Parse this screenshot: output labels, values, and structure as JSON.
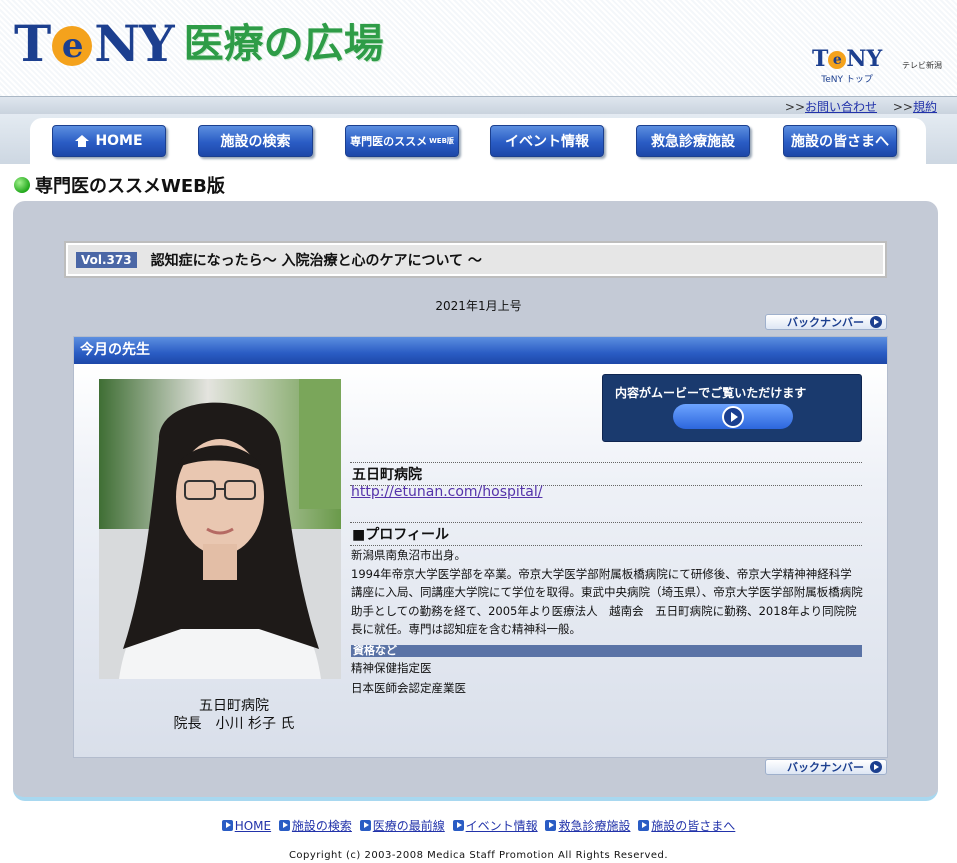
{
  "header": {
    "logo_main": "T",
    "logo_e": "e",
    "logo_rest": "NY",
    "logo_sub": "医療の広場",
    "tony_small_t": "T",
    "tony_small_e": "e",
    "tony_small_rest": "NY",
    "tony_small_caption": "テレビ新潟",
    "tony_top_link": "TeNY トップ"
  },
  "toplinks": {
    "prefix1": ">>",
    "contact": "お問い合わせ",
    "prefix2": ">>",
    "terms": "規約"
  },
  "nav": {
    "home": "HOME",
    "search": "施設の検索",
    "specialist": "専門医のススメ",
    "specialist_sub": "WEB版",
    "events": "イベント情報",
    "emergency": "救急診療施設",
    "facilities": "施設の皆さまへ"
  },
  "page": {
    "title": "専門医のススメWEB版"
  },
  "article": {
    "vol": "Vol.373",
    "title": "認知症になったら～ 入院治療と心のケアについて ～",
    "date": "2021年1月上号",
    "backnumber": "バックナンバー"
  },
  "doctor_box": {
    "header": "今月の先生",
    "caption_line1": "五日町病院",
    "caption_line2": "院長　小川 杉子 氏",
    "movie_text": "内容がムービーでご覧いただけます",
    "hospital_name": "五日町病院",
    "hospital_url": "http://etunan.com/hospital/",
    "profile_heading": "■プロフィール",
    "profile_text": "新潟県南魚沼市出身。\n1994年帝京大学医学部を卒業。帝京大学医学部附属板橋病院にて研修後、帝京大学精神神経科学講座に入局、同講座大学院にて学位を取得。東武中央病院（埼玉県）、帝京大学医学部附属板橋病院助手としての勤務を経て、2005年より医療法人　越南会　五日町病院に勤務、2018年より同院院長に就任。専門は認知症を含む精神科一般。",
    "qualifications_label": "資格など",
    "qualifications": [
      "精神保健指定医",
      "日本医師会認定産業医"
    ]
  },
  "footer": {
    "links": [
      "HOME",
      "施設の検索",
      "医療の最前線",
      "イベント情報",
      "救急診療施設",
      "施設の皆さまへ"
    ],
    "copyright": "Copyright (c) 2003-2008 Medica Staff Promotion All Rights Reserved."
  },
  "colors": {
    "brand_blue": "#1c3f8f",
    "brand_green": "#2e9c47",
    "nav_blue": "#2a5cc4",
    "panel_gray": "#c4cad6"
  }
}
